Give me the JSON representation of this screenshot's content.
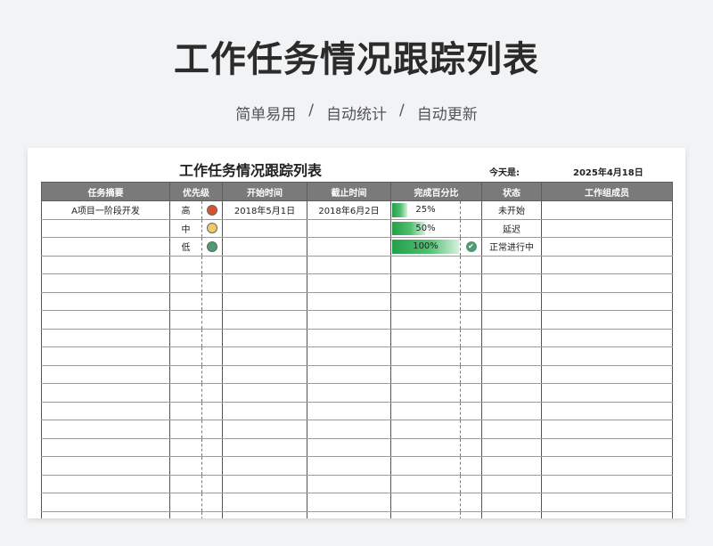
{
  "page": {
    "title": "工作任务情况跟踪列表",
    "subtitle": [
      "简单易用",
      "/",
      "自动统计",
      "/",
      "自动更新"
    ]
  },
  "sheet": {
    "title": "工作任务情况跟踪列表",
    "today_label": "今天是:",
    "today_value": "2025年4月18日",
    "headers": [
      "任务摘要",
      "优先级",
      "开始时间",
      "截止时间",
      "完成百分比",
      "状态",
      "工作组成员"
    ],
    "rows": [
      {
        "task": "A项目一阶段开发",
        "priority": "高",
        "priority_color": "#d9502f",
        "start": "2018年5月1日",
        "end": "2018年6月2日",
        "percent_label": "25%",
        "percent": 0.25,
        "done": false,
        "status": "未开始",
        "members": ""
      },
      {
        "task": "",
        "priority": "中",
        "priority_color": "#f3c86a",
        "start": "",
        "end": "",
        "percent_label": "50%",
        "percent": 0.5,
        "done": false,
        "status": "延迟",
        "members": ""
      },
      {
        "task": "",
        "priority": "低",
        "priority_color": "#4f9a70",
        "start": "",
        "end": "",
        "percent_label": "100%",
        "percent": 1.0,
        "done": true,
        "status": "正常进行中",
        "members": ""
      }
    ],
    "empty_rows": 16,
    "done_icon": "check-circle-icon"
  }
}
